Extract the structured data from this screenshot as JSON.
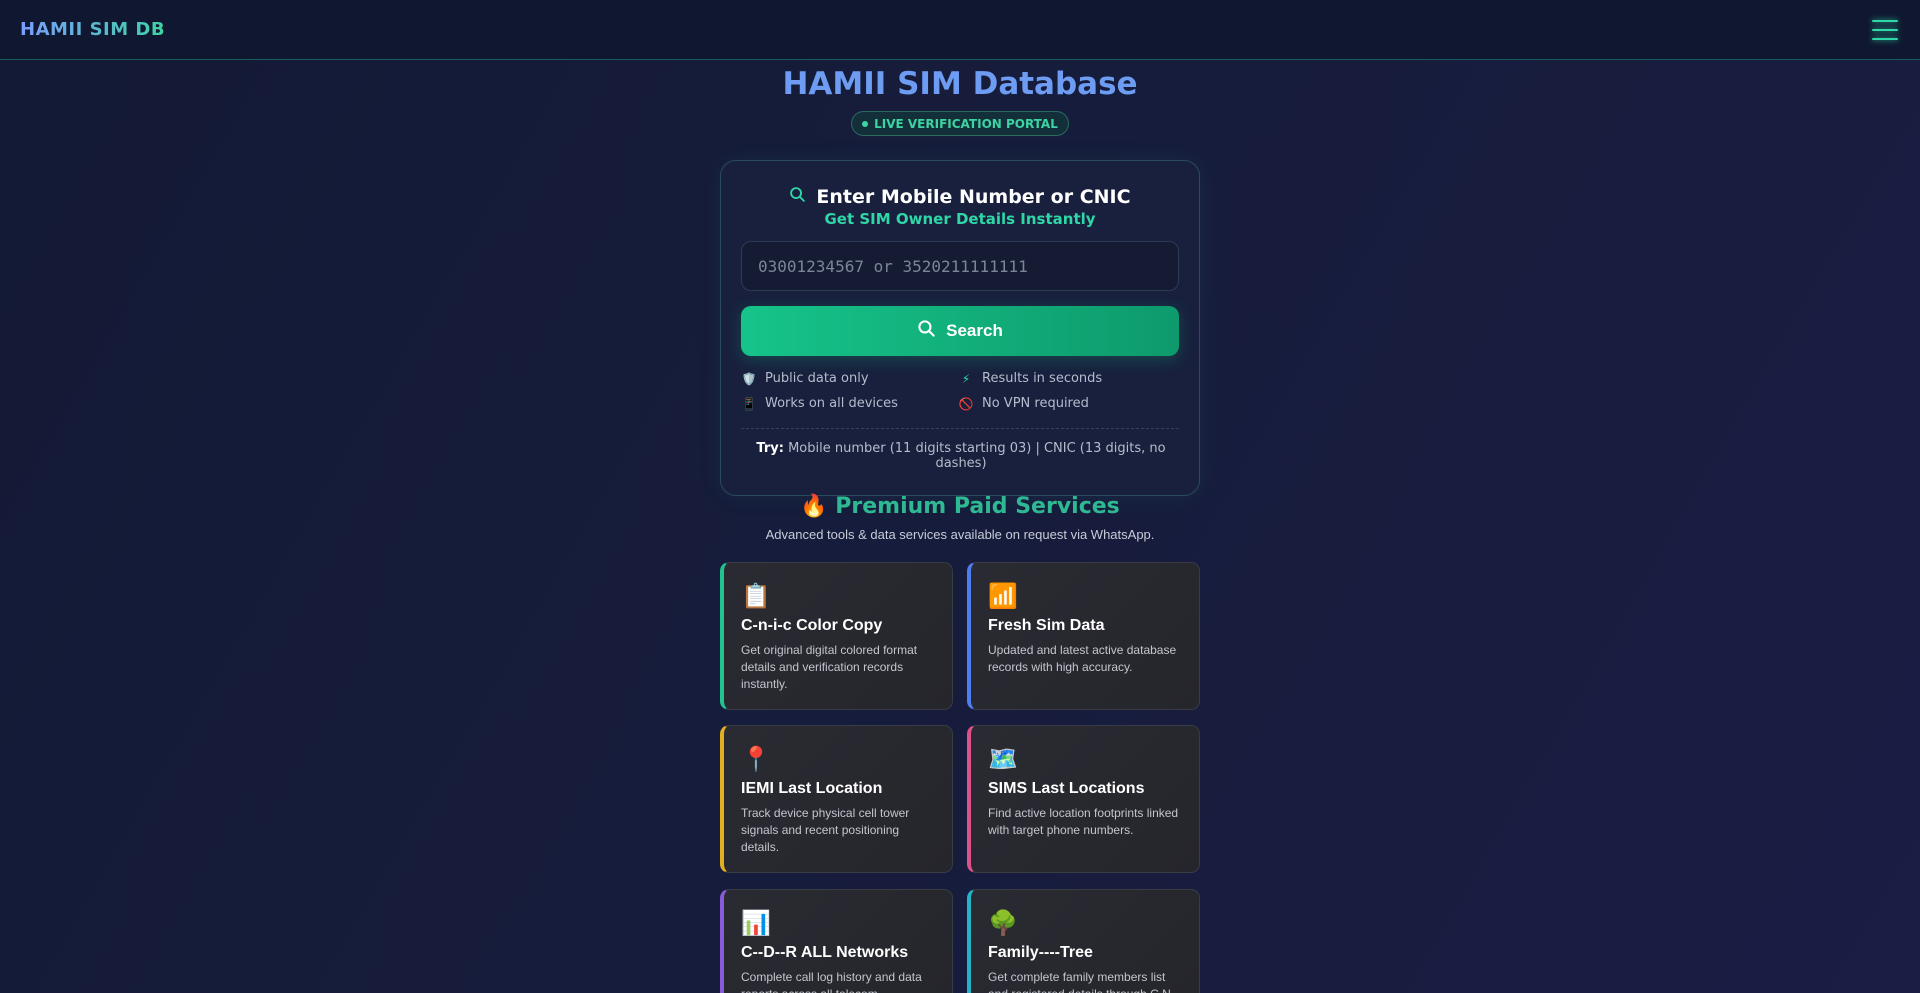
{
  "header": {
    "brand": "HAMII SIM DB"
  },
  "hero": {
    "title": "HAMII SIM Database",
    "badge": "LIVE VERIFICATION PORTAL"
  },
  "search": {
    "title": "Enter Mobile Number or CNIC",
    "subtitle": "Get SIM Owner Details Instantly",
    "placeholder": "03001234567 or 3520211111111",
    "button_label": "Search",
    "features": [
      {
        "icon": "🛡️",
        "label": "Public data only"
      },
      {
        "icon": "⚡",
        "label": "Results in seconds"
      },
      {
        "icon": "📱",
        "label": "Works on all devices"
      },
      {
        "icon": "🚫",
        "label": "No VPN required"
      }
    ],
    "try_label": "Try:",
    "try_text": "Mobile number (11 digits starting 03) | CNIC (13 digits, no dashes)"
  },
  "premium": {
    "title": "🔥 Premium Paid Services",
    "subtitle": "Advanced tools & data services available on request via WhatsApp.",
    "services": [
      {
        "icon": "📋",
        "name": "C-n-i-c Color Copy",
        "desc": "Get original digital colored format details and verification records instantly.",
        "accent": "#22c38e"
      },
      {
        "icon": "📶",
        "name": "Fresh Sim Data",
        "desc": "Updated and latest active database records with high accuracy.",
        "accent": "#4f7df0"
      },
      {
        "icon": "📍",
        "name": "IEMI Last Location",
        "desc": "Track device physical cell tower signals and recent positioning details.",
        "accent": "#e0b020"
      },
      {
        "icon": "🗺️",
        "name": "SIMS Last Locations",
        "desc": "Find active location footprints linked with target phone numbers.",
        "accent": "#e0508a"
      },
      {
        "icon": "📊",
        "name": "C--D--R ALL Networks",
        "desc": "Complete call log history and data reports across all telecom",
        "accent": "#8a5bd8"
      },
      {
        "icon": "🌳",
        "name": "Family----Tree",
        "desc": "Get complete family members list and registered details through C.N",
        "accent": "#22b5c8"
      }
    ]
  }
}
